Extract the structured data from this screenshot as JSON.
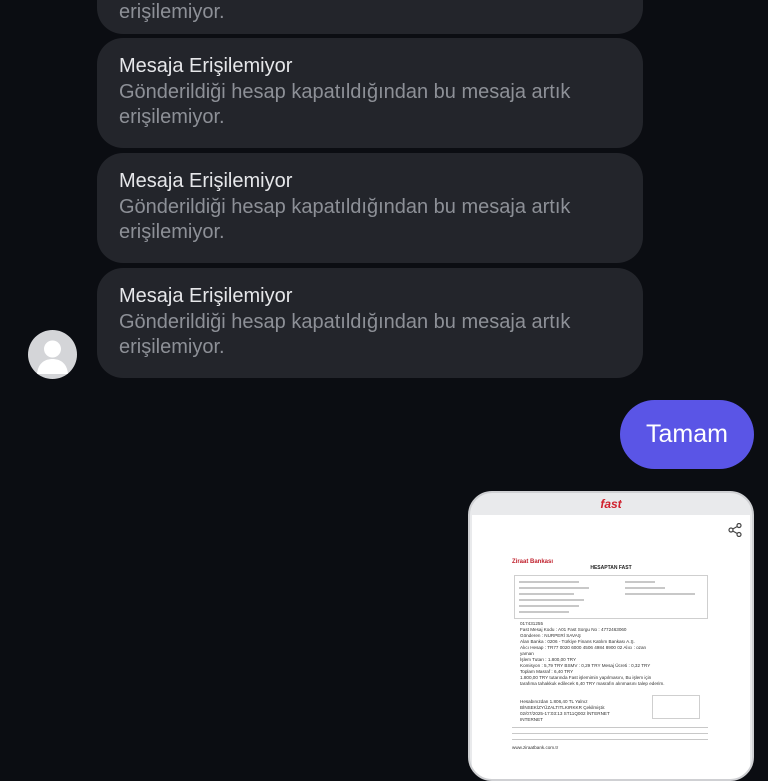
{
  "messages": [
    {
      "title": "",
      "body_line1": "",
      "body_line2": "erişilemiyor."
    },
    {
      "title": "Mesaja Erişilemiyor",
      "body_line1": "Gönderildiği hesap kapatıldığından bu mesaja artık",
      "body_line2": "erişilemiyor."
    },
    {
      "title": "Mesaja Erişilemiyor",
      "body_line1": "Gönderildiği hesap kapatıldığından bu mesaja artık",
      "body_line2": "erişilemiyor."
    },
    {
      "title": "Mesaja Erişilemiyor",
      "body_line1": "Gönderildiği hesap kapatıldığından bu mesaja artık",
      "body_line2": "erişilemiyor."
    }
  ],
  "sent_message": "Tamam",
  "receipt": {
    "brand": "fast",
    "bank": "Ziraat Bankası",
    "heading": "HESAPTAN FAST",
    "lines": [
      "017431255",
      "Fast Mesaj Kodu : A01 Fast Sorgu No : 4772463060",
      "Gönderen : NURPERİ SAVAŞ",
      "Alan Banka : 0206 - Türkiye Finans Katılım Bankası A.Ş.",
      "Alıcı Hesap : TR77 0020 6000 4506 4984 8900 02 Alıcı : ozan",
      "yaman",
      "İşlem Tutarı : 1.800,00 TRY",
      "Komisyon : 5,79 TRY BSMV : 0,29 TRY Mesaj Ücreti : 0,32 TRY",
      "Toplam Masraf : 6,40 TRY",
      "1.800,00 TRY tutarında Fast işlemimin yapılmasını, Bu işlem için",
      "tarafıma tahakkuk edilecek 6,40 TRY masrafın alınmasını talep ederim.",
      "Hesabınızdan 1.806,40 TL Yalnız",
      "BİNSEKİZYÜZALTITLKIRKKR Çekilmiştir.",
      "02/07/2025-17:03:13 ST11Q002 İNTERNET",
      "INTERNET"
    ],
    "footer": "www.ziraatbank.com.tr"
  },
  "colors": {
    "background": "#0b0d12",
    "bubble": "#23252b",
    "sent_bubble": "#5a55e6",
    "title_text": "#e6e7ea",
    "body_text": "#8d9097",
    "brand_red": "#d0202d"
  },
  "icons": {
    "avatar": "default-user-avatar-icon",
    "share": "share-icon"
  }
}
